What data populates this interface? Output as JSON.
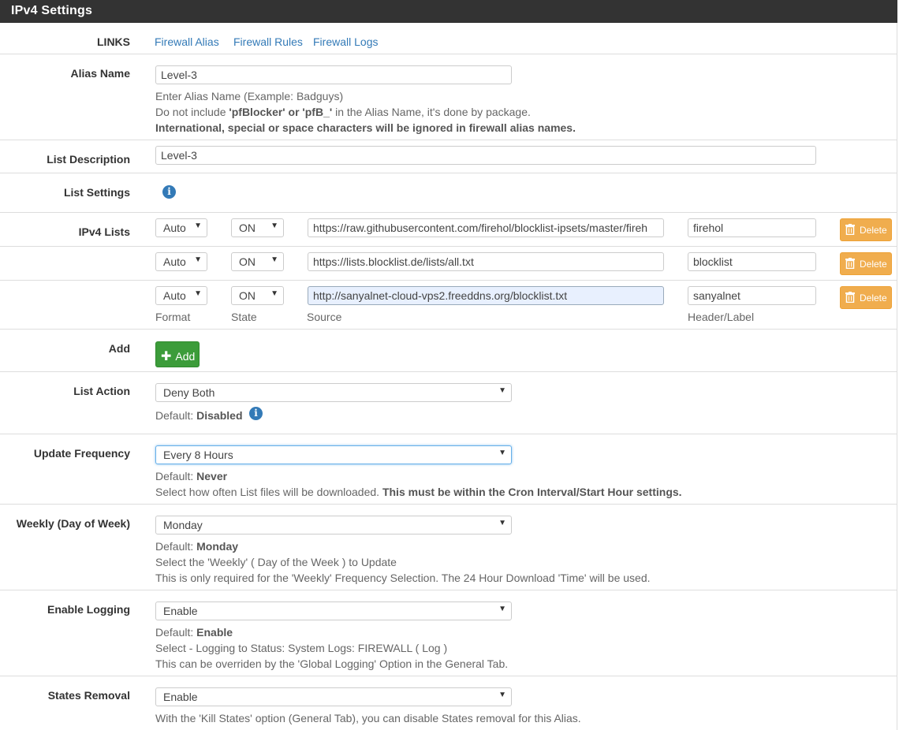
{
  "panel": {
    "title": "IPv4 Settings"
  },
  "links": {
    "label": "LINKS",
    "items": [
      "Firewall Alias",
      "Firewall Rules",
      "Firewall Logs"
    ]
  },
  "alias_name": {
    "label": "Alias Name",
    "value": "Level-3",
    "help1": "Enter Alias Name (Example: Badguys)",
    "help2_pre": "Do not include ",
    "help2_bold": "'pfBlocker' or 'pfB_'",
    "help2_post": " in the Alias Name, it's done by package.",
    "help3": "International, special or space characters will be ignored in firewall alias names."
  },
  "list_description": {
    "label": "List Description",
    "value": "Level-3"
  },
  "list_settings": {
    "label": "List Settings"
  },
  "ipv4_lists": {
    "label": "IPv4 Lists",
    "rows": [
      {
        "format": "Auto",
        "state": "ON",
        "source": "https://raw.githubusercontent.com/firehol/blocklist-ipsets/master/fireh",
        "header": "firehol",
        "delete": "Delete"
      },
      {
        "format": "Auto",
        "state": "ON",
        "source": "https://lists.blocklist.de/lists/all.txt",
        "header": "blocklist",
        "delete": "Delete"
      },
      {
        "format": "Auto",
        "state": "ON",
        "source": "http://sanyalnet-cloud-vps2.freeddns.org/blocklist.txt",
        "header": "sanyalnet",
        "delete": "Delete"
      }
    ],
    "columns": {
      "format": "Format",
      "state": "State",
      "source": "Source",
      "header": "Header/Label"
    }
  },
  "add": {
    "label": "Add",
    "button": "Add"
  },
  "list_action": {
    "label": "List Action",
    "value": "Deny Both",
    "default_label": "Default: ",
    "default_value": "Disabled"
  },
  "update_frequency": {
    "label": "Update Frequency",
    "value": "Every 8 Hours",
    "default_label": "Default: ",
    "default_value": "Never",
    "help_pre": "Select how often List files will be downloaded. ",
    "help_bold": "This must be within the Cron Interval/Start Hour settings."
  },
  "weekly": {
    "label": "Weekly (Day of Week)",
    "value": "Monday",
    "default_label": "Default: ",
    "default_value": "Monday",
    "help1": "Select the 'Weekly' ( Day of the Week ) to Update",
    "help2": "This is only required for the 'Weekly' Frequency Selection. The 24 Hour Download 'Time' will be used."
  },
  "enable_logging": {
    "label": "Enable Logging",
    "value": "Enable",
    "default_label": "Default: ",
    "default_value": "Enable",
    "help1": "Select - Logging to Status: System Logs: FIREWALL ( Log )",
    "help2": "This can be overriden by the 'Global Logging' Option in the General Tab."
  },
  "states_removal": {
    "label": "States Removal",
    "value": "Enable",
    "help1": "With the 'Kill States' option (General Tab), you can disable States removal for this Alias."
  },
  "colors": {
    "header_bg": "#333333",
    "link": "#337ab7",
    "delete_btn": "#f0ad4e",
    "add_btn": "#3c9c3a"
  }
}
